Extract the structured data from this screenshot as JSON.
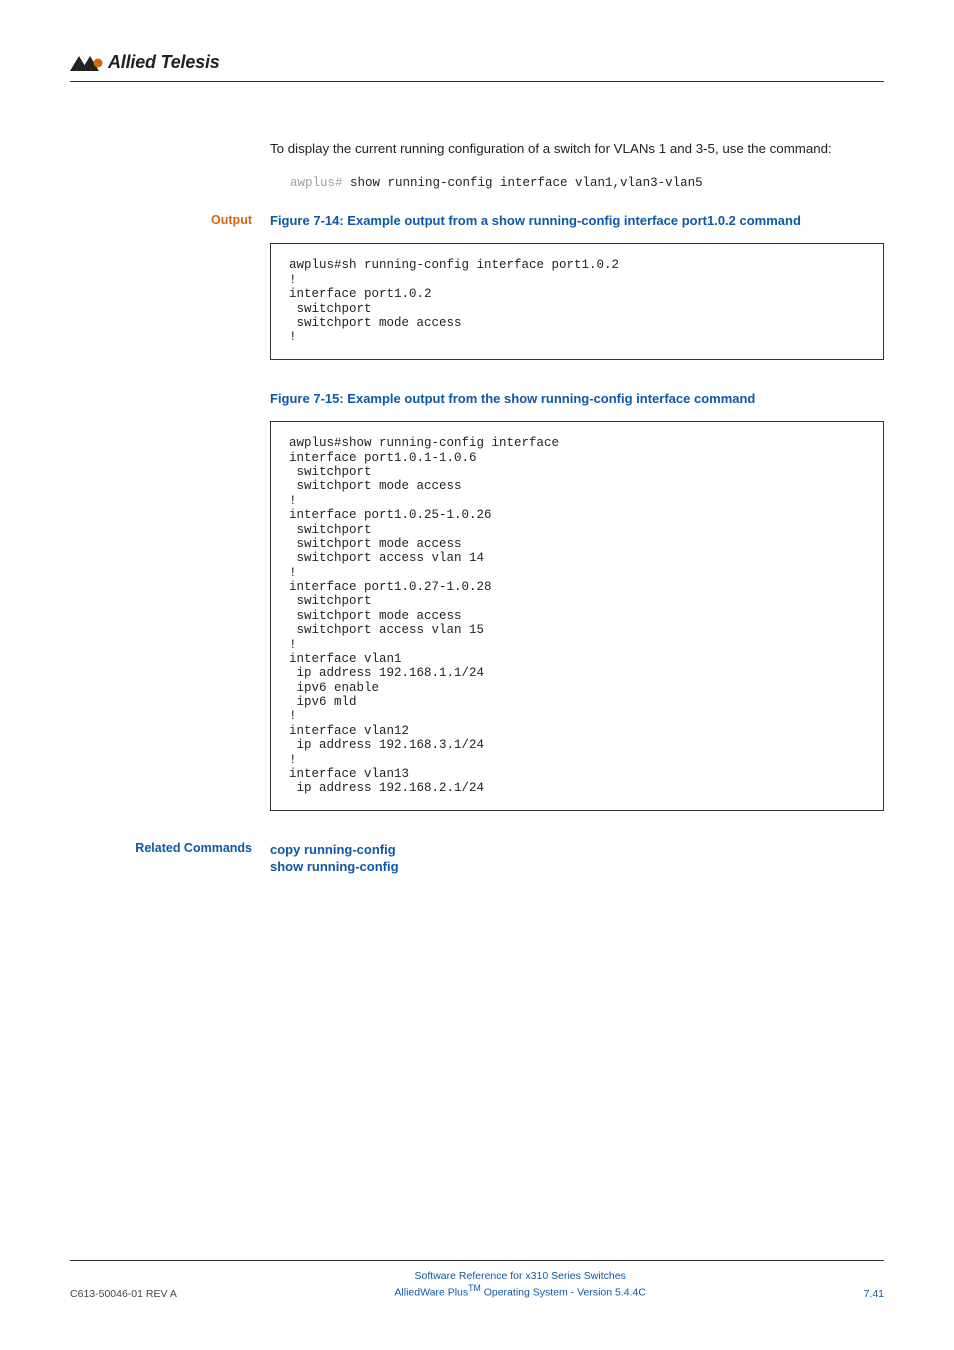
{
  "header": {
    "logo_text": "Allied Telesis"
  },
  "intro": {
    "text": "To display the current running configuration of a switch for VLANs 1 and 3-5, use the command:"
  },
  "cmd": {
    "prompt": "awplus#",
    "command": " show running-config interface vlan1,vlan3-vlan5"
  },
  "output_label": "Output",
  "fig14": {
    "title": "Figure 7-14: Example output from a show running-config interface port1.0.2 command",
    "code": "awplus#sh running-config interface port1.0.2\n!\ninterface port1.0.2\n switchport\n switchport mode access\n!"
  },
  "fig15": {
    "title": "Figure 7-15: Example output from the show running-config interface command",
    "code": "awplus#show running-config interface\ninterface port1.0.1-1.0.6\n switchport\n switchport mode access\n!\ninterface port1.0.25-1.0.26\n switchport\n switchport mode access\n switchport access vlan 14\n!\ninterface port1.0.27-1.0.28\n switchport\n switchport mode access\n switchport access vlan 15\n!\ninterface vlan1\n ip address 192.168.1.1/24\n ipv6 enable\n ipv6 mld\n!\ninterface vlan12\n ip address 192.168.3.1/24\n!\ninterface vlan13\n ip address 192.168.2.1/24"
  },
  "related": {
    "label": "Related Commands",
    "links": [
      "copy running-config",
      "show running-config"
    ]
  },
  "footer": {
    "left": "C613-50046-01 REV A",
    "center1": "Software Reference for x310 Series Switches",
    "center2_a": "AlliedWare Plus",
    "center2_b": "TM",
    "center2_c": " Operating System - Version 5.4.4C",
    "right": "7.41"
  }
}
